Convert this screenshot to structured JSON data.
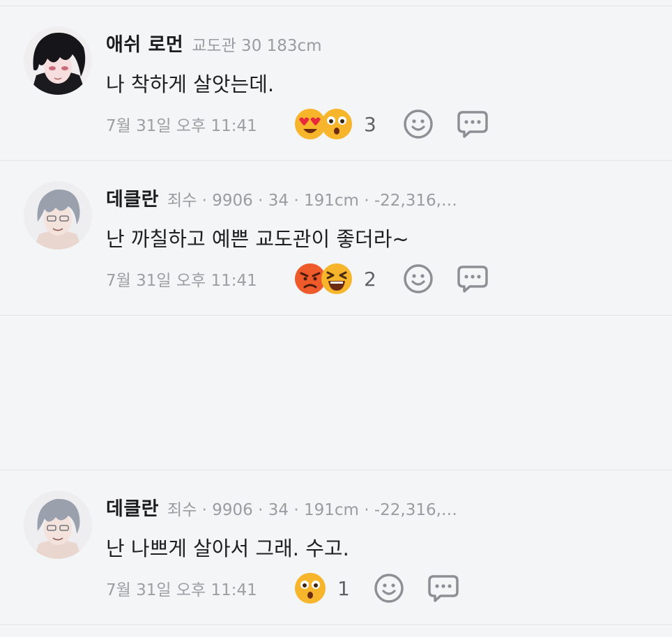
{
  "comments": [
    {
      "author": "애쉬 로먼",
      "meta": "교도관 30 183cm",
      "text": "나 착하게 살앗는데.",
      "time": "7월 31일 오후 11:41",
      "reactions": [
        "heart-eyes-emoji",
        "surprised-emoji"
      ],
      "reaction_count": "3"
    },
    {
      "author": "데클란",
      "meta": "죄수 · 9906 · 34 · 191cm · -22,316,…",
      "text": "난 까칠하고 예쁜 교도관이 좋더라~",
      "time": "7월 31일 오후 11:41",
      "reactions": [
        "angry-emoji",
        "squinting-laugh-emoji"
      ],
      "reaction_count": "2"
    },
    {
      "author": "데클란",
      "meta": "죄수 · 9906 · 34 · 191cm · -22,316,…",
      "text": "난 나쁘게 살아서 그래. 수고.",
      "time": "7월 31일 오후 11:41",
      "reactions": [
        "surprised-emoji"
      ],
      "reaction_count": "1"
    }
  ],
  "icons": {
    "add_reaction": "smiley-outline-icon",
    "reply": "speech-bubble-icon"
  },
  "colors": {
    "background": "#f4f5f7",
    "divider": "#e3e4e7",
    "meta_text": "#9a9ca1",
    "icon_gray": "#8d8f94"
  }
}
